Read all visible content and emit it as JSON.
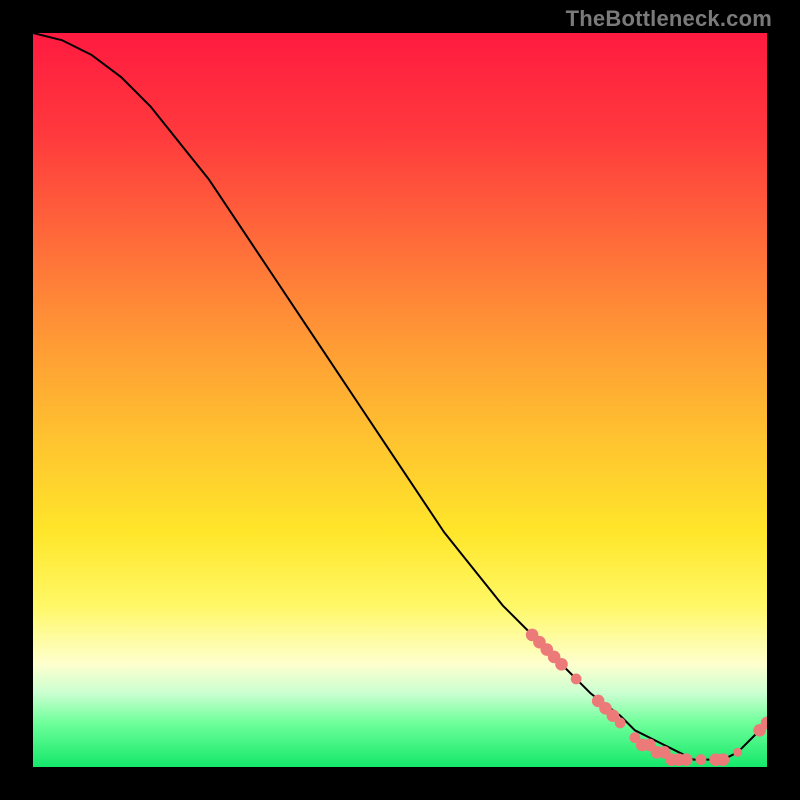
{
  "watermark": "TheBottleneck.com",
  "colors": {
    "marker": "#ec7a78",
    "line": "#000000",
    "background": "#000000"
  },
  "chart_data": {
    "type": "line",
    "title": "",
    "xlabel": "",
    "ylabel": "",
    "xlim": [
      0,
      100
    ],
    "ylim": [
      0,
      100
    ],
    "grid": false,
    "series": [
      {
        "name": "curve",
        "x": [
          0,
          4,
          8,
          12,
          16,
          20,
          24,
          28,
          32,
          36,
          40,
          44,
          48,
          52,
          56,
          60,
          64,
          68,
          72,
          76,
          80,
          82,
          84,
          86,
          88,
          90,
          92,
          94,
          96,
          98,
          100
        ],
        "y": [
          100,
          99,
          97,
          94,
          90,
          85,
          80,
          74,
          68,
          62,
          56,
          50,
          44,
          38,
          32,
          27,
          22,
          18,
          14,
          10,
          7,
          5,
          4,
          3,
          2,
          1,
          1,
          1,
          2,
          4,
          6
        ]
      }
    ],
    "markers": [
      {
        "x": 68,
        "y": 18,
        "r": 3.5
      },
      {
        "x": 69,
        "y": 17,
        "r": 3.5
      },
      {
        "x": 70,
        "y": 16,
        "r": 3.5
      },
      {
        "x": 71,
        "y": 15,
        "r": 3.5
      },
      {
        "x": 72,
        "y": 14,
        "r": 3.5
      },
      {
        "x": 74,
        "y": 12,
        "r": 3.0
      },
      {
        "x": 77,
        "y": 9,
        "r": 3.5
      },
      {
        "x": 78,
        "y": 8,
        "r": 3.5
      },
      {
        "x": 79,
        "y": 7,
        "r": 3.5
      },
      {
        "x": 80,
        "y": 6,
        "r": 3.0
      },
      {
        "x": 82,
        "y": 4,
        "r": 3.0
      },
      {
        "x": 83,
        "y": 3,
        "r": 3.5
      },
      {
        "x": 84,
        "y": 3,
        "r": 3.5
      },
      {
        "x": 85,
        "y": 2,
        "r": 3.5
      },
      {
        "x": 86,
        "y": 2,
        "r": 3.5
      },
      {
        "x": 87,
        "y": 1,
        "r": 3.5
      },
      {
        "x": 88,
        "y": 1,
        "r": 3.5
      },
      {
        "x": 89,
        "y": 1,
        "r": 3.5
      },
      {
        "x": 91,
        "y": 1,
        "r": 3.0
      },
      {
        "x": 93,
        "y": 1,
        "r": 3.5
      },
      {
        "x": 94,
        "y": 1,
        "r": 3.5
      },
      {
        "x": 96,
        "y": 2,
        "r": 2.5
      },
      {
        "x": 99,
        "y": 5,
        "r": 3.5
      },
      {
        "x": 100,
        "y": 6,
        "r": 3.5
      }
    ]
  }
}
